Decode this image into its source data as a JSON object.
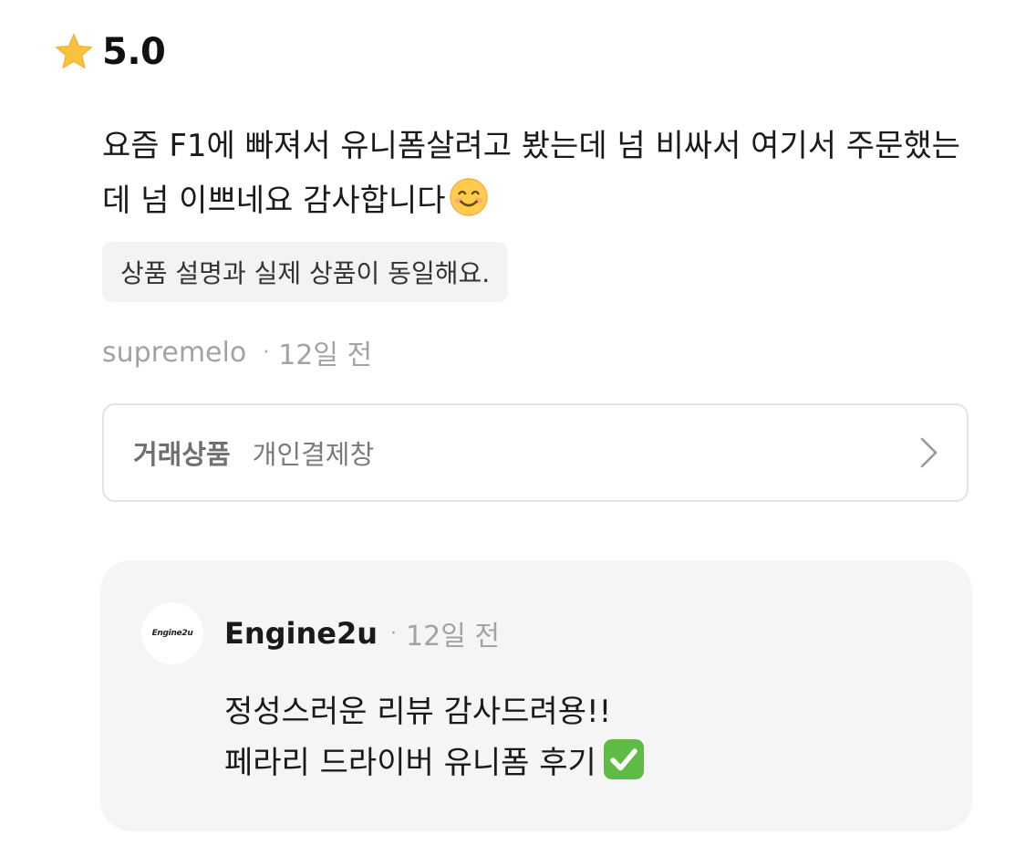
{
  "review": {
    "rating": "5.0",
    "text": "요즘 F1에 빠져서 유니폼살려고 봤는데 넘 비싸서 여기서 주문했는데 넘 이쁘네요 감사합니다",
    "emoji": "smiling-face-icon",
    "tag": "상품 설명과 실제 상품이 동일해요.",
    "author": "supremelo",
    "separator": "·",
    "time": "12일 전"
  },
  "product": {
    "label": "거래상품",
    "name": "개인결제창"
  },
  "reply": {
    "seller_name": "Engine2u",
    "avatar_text": "Engine2u",
    "separator": "·",
    "time": "12일 전",
    "line1": "정성스러운 리뷰 감사드려용!!",
    "line2": "페라리 드라이버 유니폼 후기",
    "line2_icon": "check-mark-button-icon"
  },
  "colors": {
    "star": "#F9C23C",
    "muted_text": "#A3A3A3",
    "chip_bg": "#F3F3F3",
    "reply_bg": "#F5F5F5",
    "check_green": "#5DBB46"
  }
}
